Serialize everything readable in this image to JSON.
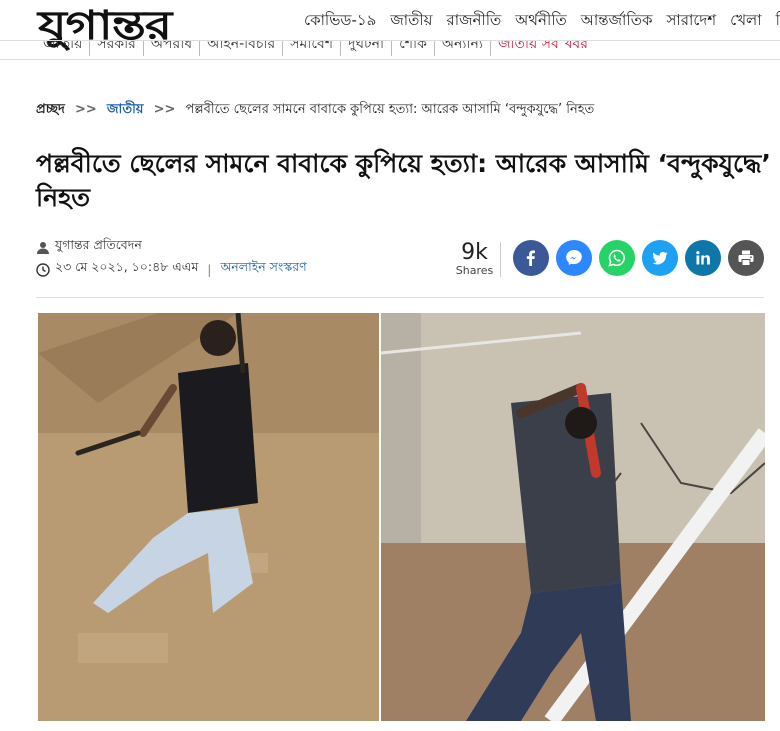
{
  "site": {
    "logo_text": "যুগান্তর"
  },
  "main_nav": [
    "কোভিড-১৯",
    "জাতীয়",
    "রাজনীতি",
    "অর্থনীতি",
    "আন্তর্জাতিক",
    "সারাদেশ",
    "খেলা",
    "বি"
  ],
  "sub_nav": [
    "জাতীয়",
    "সরকার",
    "অপরাধ",
    "আইন-বিচার",
    "সমাবেশ",
    "দুর্ঘটনা",
    "শোক",
    "অন্যান্য",
    "জাতীয় সব খবর"
  ],
  "breadcrumb": {
    "home": "প্রচ্ছদ",
    "separator": ">>",
    "category": "জাতীয়",
    "current": "পল্লবীতে ছেলের সামনে বাবাকে কুপিয়ে হত্যা: আরেক আসামি ‘বন্দুকযুদ্ধে’ নিহত"
  },
  "article": {
    "headline": "পল্লবীতে ছেলের সামনে বাবাকে কুপিয়ে হত্যা: আরেক আসামি ‘বন্দুকযুদ্ধে’ নিহত",
    "author": "যুগান্তর প্রতিবেদন",
    "datetime": "২৩ মে ২০২১, ১০:৪৮ এএম",
    "meta_separator": "|",
    "edition": "অনলাইন সংস্করণ"
  },
  "share": {
    "count": "9k",
    "label": "Shares",
    "buttons": [
      {
        "name": "facebook",
        "color": "#3b5998"
      },
      {
        "name": "messenger",
        "color": "#2d88ff"
      },
      {
        "name": "whatsapp",
        "color": "#25d366"
      },
      {
        "name": "twitter",
        "color": "#1da1f2"
      },
      {
        "name": "linkedin",
        "color": "#0e76a8"
      },
      {
        "name": "print",
        "color": "#555555"
      }
    ]
  }
}
